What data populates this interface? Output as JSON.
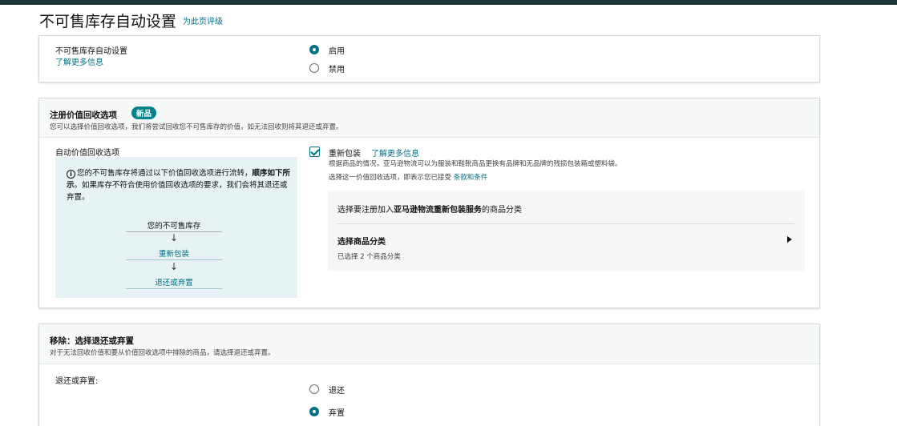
{
  "page": {
    "title": "不可售库存自动设置",
    "rate_link": "为此页评级"
  },
  "auto_settings": {
    "label": "不可售库存自动设置",
    "learn_more": "了解更多信息",
    "options": [
      {
        "label": "启用",
        "selected": true
      },
      {
        "label": "禁用",
        "selected": false
      }
    ]
  },
  "recovery": {
    "title": "注册价值回收选项",
    "badge": "新品",
    "description": "您可以选择价值回收选项，我们将尝试回收您不可售库存的价值，如无法回收则将其退还或弃置。",
    "auto_label": "自动价值回收选项",
    "info": {
      "text_pre": "您的不可售库存将通过以下价值回收选项进行流转，",
      "text_bold": "顺序如下所示",
      "text_post": "。如果库存不符合使用价值回收选项的要求，我们会将其退还或弃置。",
      "flow": [
        "您的不可售库存",
        "重新包装",
        "退还或弃置"
      ],
      "arrow": "↓"
    },
    "repack": {
      "checked": true,
      "label": "重新包装",
      "learn_more": "了解更多信息",
      "desc": "根据商品的情况，亚马逊物流可以为服装和鞋靴商品更换有品牌和无品牌的残损包装箱或塑料袋。",
      "terms_prefix": "选择这一价值回收选项，即表示您已接受",
      "terms_link": "条款和条件"
    },
    "category": {
      "prompt_pre": "选择要注册加入",
      "prompt_bold": "亚马逊物流重新包装服务",
      "prompt_post": "的商品分类",
      "select_label": "选择商品分类",
      "selected_count": "已选择 2 个商品分类",
      "expand_icon": "triangle-right-icon"
    }
  },
  "removal": {
    "title": "移除：选择退还或弃置",
    "description": "对于无法回收价值和要从价值回收选项中排除的商品，请选择退还或弃置。",
    "label": "退还或弃置:",
    "options": [
      {
        "label": "退还",
        "selected": false
      },
      {
        "label": "弃置",
        "selected": true
      }
    ]
  },
  "colors": {
    "accent": "#007185",
    "badge": "#00838a",
    "topbar": "#1a3438",
    "info_bg": "#e6f2f3"
  }
}
